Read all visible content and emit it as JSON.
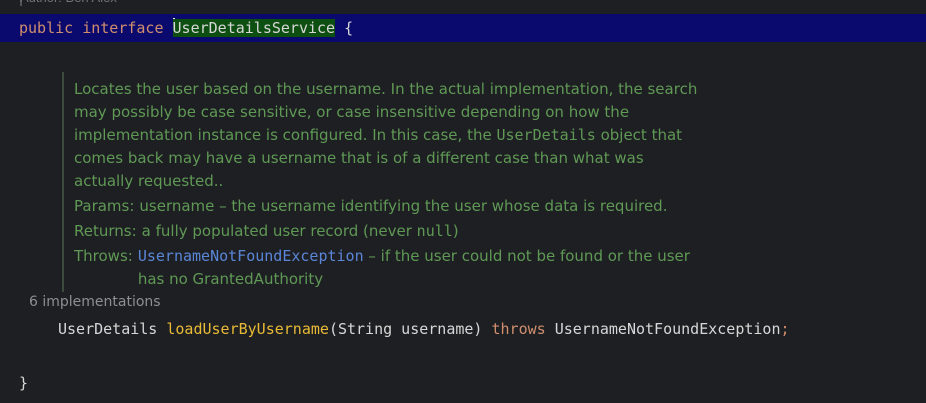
{
  "header": {
    "clipped_text": "Author: Ben Alex"
  },
  "interface_decl": {
    "kw_public": "public",
    "kw_interface": "interface",
    "name": "UserDetailsService",
    "brace": "{"
  },
  "javadoc": {
    "desc_1": "Locates the user based on the username. In the actual implementation, the search may possibly be case sensitive, or case insensitive depending on how the implementation instance is configured. In this case, the ",
    "desc_code": "UserDetails",
    "desc_2": " object that comes back may have a username that is of a different case than what was actually requested..",
    "params_tag": "Params:",
    "params_val": "username – the username identifying the user whose data is required.",
    "returns_tag": "Returns:",
    "returns_val_1": "a fully populated user record (never ",
    "returns_code": "null",
    "returns_val_2": ")",
    "throws_tag": "Throws:",
    "throws_link": "UsernameNotFoundException",
    "throws_val": " – if the user could not be found or the user has no GrantedAuthority"
  },
  "implementations_hint": "6 implementations",
  "method_decl": {
    "return_type": "UserDetails",
    "method_name": "loadUserByUsername",
    "params": "(String username)",
    "kw_throws": "throws",
    "exception": "UsernameNotFoundException",
    "terminator": ";"
  },
  "closing_brace": "}"
}
